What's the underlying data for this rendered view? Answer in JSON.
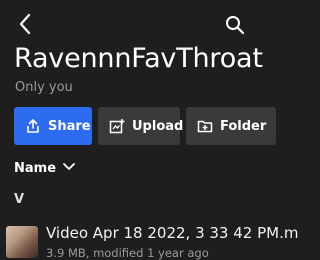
{
  "header": {
    "back_icon": "chevron-left-icon",
    "search_icon": "search-icon",
    "title": "RavennnFavThroat",
    "subtitle": "Only you"
  },
  "actions": {
    "share_label": "Share",
    "upload_label": "Upload",
    "folder_label": "Folder",
    "share_color": "#2d6cf0"
  },
  "list": {
    "sort_label": "Name",
    "section_letter": "V",
    "items": [
      {
        "name": "Video Apr 18 2022, 3 33 42 PM.m",
        "meta": "3.9 MB, modified 1 year ago"
      }
    ]
  }
}
